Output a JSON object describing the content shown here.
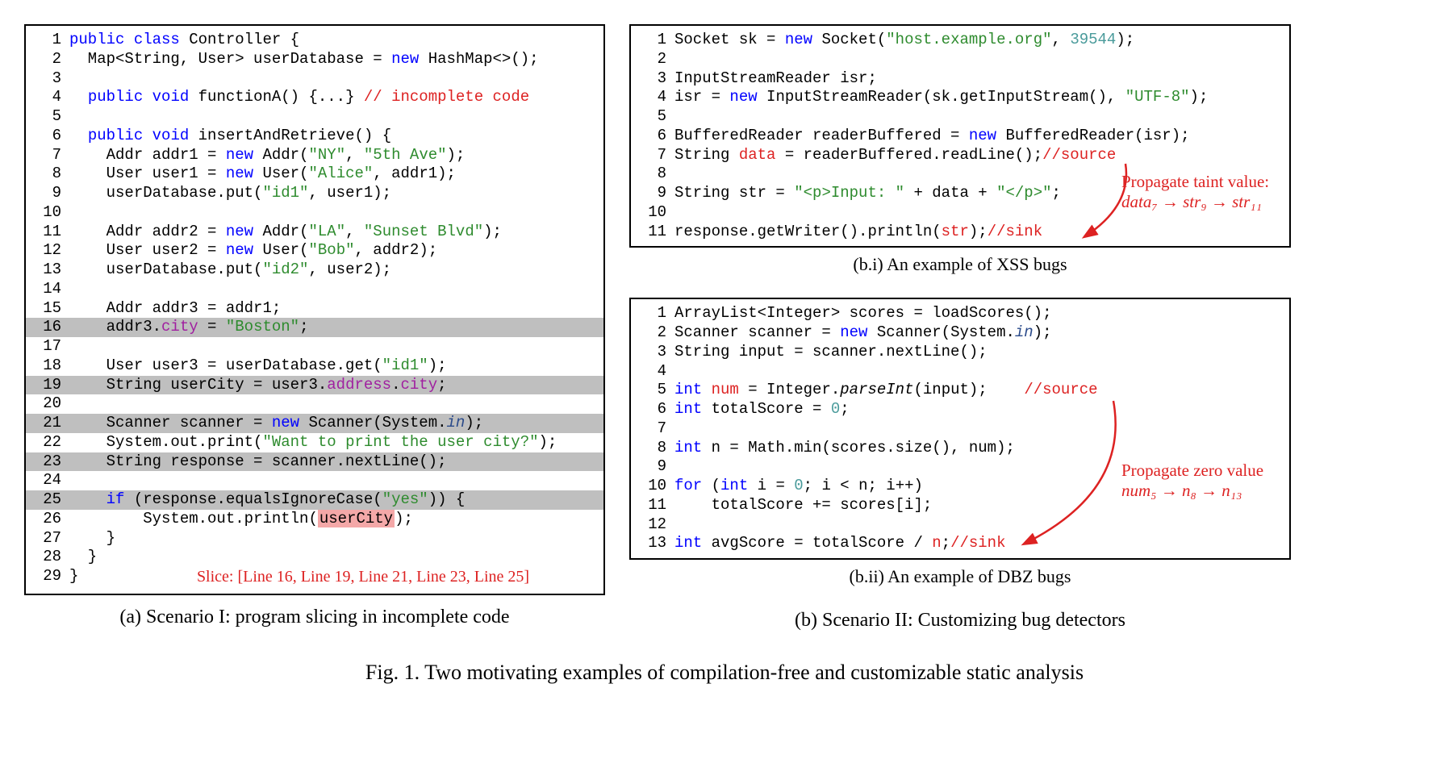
{
  "codeA": {
    "lines": [
      {
        "n": "1",
        "hl": false,
        "html": "<span class=\"kw\">public</span> <span class=\"kw\">class</span> Controller {"
      },
      {
        "n": "2",
        "hl": false,
        "html": "  Map&lt;String, User&gt; userDatabase = <span class=\"kw\">new</span> HashMap&lt;&gt;();"
      },
      {
        "n": "3",
        "hl": false,
        "html": ""
      },
      {
        "n": "4",
        "hl": false,
        "html": "  <span class=\"kw\">public</span> <span class=\"kw\">void</span> functionA() {...} <span class=\"cmt\">// incomplete code</span>"
      },
      {
        "n": "5",
        "hl": false,
        "html": ""
      },
      {
        "n": "6",
        "hl": false,
        "html": "  <span class=\"kw\">public</span> <span class=\"kw\">void</span> insertAndRetrieve() {"
      },
      {
        "n": "7",
        "hl": false,
        "html": "    Addr addr1 = <span class=\"kw\">new</span> Addr(<span class=\"str\">\"NY\"</span>, <span class=\"str\">\"5th Ave\"</span>);"
      },
      {
        "n": "8",
        "hl": false,
        "html": "    User user1 = <span class=\"kw\">new</span> User(<span class=\"str\">\"Alice\"</span>, addr1);"
      },
      {
        "n": "9",
        "hl": false,
        "html": "    userDatabase.put(<span class=\"str\">\"id1\"</span>, user1);"
      },
      {
        "n": "10",
        "hl": false,
        "html": ""
      },
      {
        "n": "11",
        "hl": false,
        "html": "    Addr addr2 = <span class=\"kw\">new</span> Addr(<span class=\"str\">\"LA\"</span>, <span class=\"str\">\"Sunset Blvd\"</span>);"
      },
      {
        "n": "12",
        "hl": false,
        "html": "    User user2 = <span class=\"kw\">new</span> User(<span class=\"str\">\"Bob\"</span>, addr2);"
      },
      {
        "n": "13",
        "hl": false,
        "html": "    userDatabase.put(<span class=\"str\">\"id2\"</span>, user2);"
      },
      {
        "n": "14",
        "hl": false,
        "html": ""
      },
      {
        "n": "15",
        "hl": false,
        "html": "    Addr addr3 = addr1;"
      },
      {
        "n": "16",
        "hl": true,
        "html": "    addr3.<span class=\"prop\">city</span> = <span class=\"str\">\"Boston\"</span>;"
      },
      {
        "n": "17",
        "hl": false,
        "html": ""
      },
      {
        "n": "18",
        "hl": false,
        "html": "    User user3 = userDatabase.get(<span class=\"str\">\"id1\"</span>);"
      },
      {
        "n": "19",
        "hl": true,
        "html": "    String userCity = user3.<span class=\"prop\">address</span>.<span class=\"prop\">city</span>;"
      },
      {
        "n": "20",
        "hl": false,
        "html": ""
      },
      {
        "n": "21",
        "hl": true,
        "html": "    Scanner scanner = <span class=\"kw\">new</span> Scanner(System.<span class=\"ital\">in</span>);"
      },
      {
        "n": "22",
        "hl": false,
        "html": "    System.out.print(<span class=\"str\">\"Want to print the user city?\"</span>);"
      },
      {
        "n": "23",
        "hl": true,
        "html": "    String response = scanner.nextLine();"
      },
      {
        "n": "24",
        "hl": false,
        "html": ""
      },
      {
        "n": "25",
        "hl": true,
        "html": "    <span class=\"kw\">if</span> (response.equalsIgnoreCase(<span class=\"str\">\"yes\"</span>)) {"
      },
      {
        "n": "26",
        "hl": false,
        "html": "        System.out.println(<span class=\"redbox\">userCity</span>);"
      },
      {
        "n": "27",
        "hl": false,
        "html": "    }"
      },
      {
        "n": "28",
        "hl": false,
        "html": "  }"
      },
      {
        "n": "29",
        "hl": false,
        "html": "}"
      }
    ],
    "slice": "Slice: [Line 16, Line 19, Line 21, Line 23, Line 25]"
  },
  "codeB1": {
    "lines": [
      {
        "n": "1",
        "hl": false,
        "html": "Socket sk = <span class=\"kw\">new</span> Socket(<span class=\"str2\">\"host.example.org\"</span>, <span class=\"num\">39544</span>);"
      },
      {
        "n": "2",
        "hl": false,
        "html": ""
      },
      {
        "n": "3",
        "hl": false,
        "html": "InputStreamReader isr;"
      },
      {
        "n": "4",
        "hl": false,
        "html": "isr = <span class=\"kw\">new</span> InputStreamReader(sk.getInputStream(), <span class=\"str\">\"UTF-8\"</span>);"
      },
      {
        "n": "5",
        "hl": false,
        "html": ""
      },
      {
        "n": "6",
        "hl": false,
        "html": "BufferedReader readerBuffered = <span class=\"kw\">new</span> BufferedReader(isr);"
      },
      {
        "n": "7",
        "hl": false,
        "html": "String <span class=\"red\">data</span> = readerBuffered.readLine();<span class=\"cmt\">//source</span>"
      },
      {
        "n": "8",
        "hl": false,
        "html": ""
      },
      {
        "n": "9",
        "hl": false,
        "html": "String str = <span class=\"str2\">\"&lt;p&gt;Input: \"</span> + data + <span class=\"str2\">\"&lt;/p&gt;\"</span>;"
      },
      {
        "n": "10",
        "hl": false,
        "html": ""
      },
      {
        "n": "11",
        "hl": false,
        "html": "response.getWriter().println(<span class=\"red\">str</span>);<span class=\"cmt\">//sink</span>"
      }
    ],
    "annotation": "Propagate taint value:",
    "annotation2": "data₇ → str₉ → str₁₁"
  },
  "codeB2": {
    "lines": [
      {
        "n": "1",
        "hl": false,
        "html": "ArrayList&lt;Integer&gt; scores = loadScores();"
      },
      {
        "n": "2",
        "hl": false,
        "html": "Scanner scanner = <span class=\"kw\">new</span> Scanner(System.<span class=\"ital\">in</span>);"
      },
      {
        "n": "3",
        "hl": false,
        "html": "String input = scanner.nextLine();"
      },
      {
        "n": "4",
        "hl": false,
        "html": ""
      },
      {
        "n": "5",
        "hl": false,
        "html": "<span class=\"kw\">int</span> <span class=\"red\">num</span> = Integer.<span style=\"font-style:italic\">parseInt</span>(input);    <span class=\"cmt\">//source</span>"
      },
      {
        "n": "6",
        "hl": false,
        "html": "<span class=\"kw\">int</span> totalScore = <span class=\"num\">0</span>;"
      },
      {
        "n": "7",
        "hl": false,
        "html": ""
      },
      {
        "n": "8",
        "hl": false,
        "html": "<span class=\"kw\">int</span> n = Math.min(scores.size(), num);"
      },
      {
        "n": "9",
        "hl": false,
        "html": ""
      },
      {
        "n": "10",
        "hl": false,
        "html": "<span class=\"kw\">for</span> (<span class=\"kw\">int</span> i = <span class=\"num\">0</span>; i &lt; n; i++)"
      },
      {
        "n": "11",
        "hl": false,
        "html": "    totalScore += scores[i];"
      },
      {
        "n": "12",
        "hl": false,
        "html": ""
      },
      {
        "n": "13",
        "hl": false,
        "html": "<span class=\"kw\">int</span> avgScore = totalScore / <span class=\"red\">n</span>;<span class=\"cmt\">//sink</span>"
      }
    ],
    "annotation": "Propagate zero value",
    "annotation2": "num₅ → n₈ → n₁₃"
  },
  "captions": {
    "a": "(a) Scenario I: program slicing in incomplete code",
    "bi": "(b.i) An example of XSS bugs",
    "bii": "(b.ii) An example of DBZ bugs",
    "b": "(b) Scenario II: Customizing bug detectors",
    "main": "Fig. 1.  Two motivating examples of compilation-free and customizable static analysis"
  }
}
